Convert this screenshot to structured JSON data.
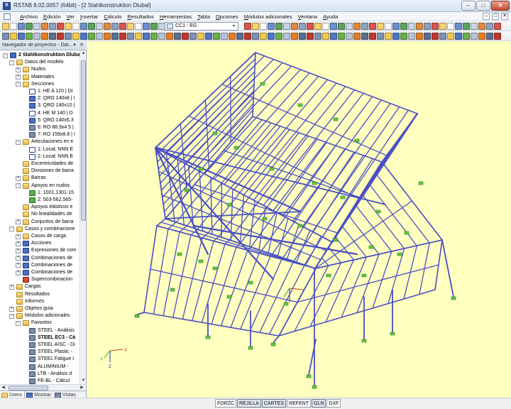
{
  "window": {
    "title": "RSTAB 8.02.0057 (64bit) - [2 Stahlkonstruktion Dlubal]",
    "minimize": "–",
    "maximize": "□",
    "close": "✕"
  },
  "menubar": {
    "items": [
      "Archivo",
      "Edición",
      "Ver",
      "Insertar",
      "Cálculo",
      "Resultados",
      "Herramientas",
      "Tabla",
      "Opciones",
      "Módulos adicionales",
      "Ventana",
      "Ayuda"
    ],
    "mdi": [
      "–",
      "□",
      "✕"
    ]
  },
  "toolbar": {
    "loadcase_combo": "CC1 - EG",
    "combo_arrow": "▾"
  },
  "navigator": {
    "title": "Navegador de proyectos - Dat...",
    "pin": "▾",
    "close": "✕",
    "rows": [
      {
        "label": "2 Stahlkonstruktion Dlubal",
        "level": 0,
        "icon": "model",
        "exp": "-",
        "bold": true
      },
      {
        "label": "Datos del modelo",
        "level": 1,
        "icon": "folder",
        "exp": "-"
      },
      {
        "label": "Nudos",
        "level": 2,
        "icon": "folder",
        "exp": "+"
      },
      {
        "label": "Materiales",
        "level": 2,
        "icon": "folder",
        "exp": "+"
      },
      {
        "label": "Secciones",
        "level": 2,
        "icon": "folder",
        "exp": "-"
      },
      {
        "label": "1: HE A 120 | DI",
        "level": 3,
        "icon": "section",
        "exp": ""
      },
      {
        "label": "2: QRO 140x8 | I",
        "level": 3,
        "icon": "blue",
        "exp": ""
      },
      {
        "label": "3: QRO 140x10 |",
        "level": 3,
        "icon": "blue",
        "exp": ""
      },
      {
        "label": "4: HE M 140 | D",
        "level": 3,
        "icon": "section",
        "exp": ""
      },
      {
        "label": "5: QRO 140x6.3",
        "level": 3,
        "icon": "blue",
        "exp": ""
      },
      {
        "label": "6: RO 88.9x4.5 |",
        "level": 3,
        "icon": "module",
        "exp": ""
      },
      {
        "label": "7: RO 159x8.8 | I",
        "level": 3,
        "icon": "module",
        "exp": ""
      },
      {
        "label": "Articulaciones en e",
        "level": 2,
        "icon": "folder",
        "exp": "-"
      },
      {
        "label": "1: Local; NNN E",
        "level": 3,
        "icon": "section",
        "exp": ""
      },
      {
        "label": "2: Local; NNN E",
        "level": 3,
        "icon": "section",
        "exp": ""
      },
      {
        "label": "Excentricidades de",
        "level": 2,
        "icon": "folder",
        "exp": ""
      },
      {
        "label": "Divisiones de barra",
        "level": 2,
        "icon": "folder",
        "exp": ""
      },
      {
        "label": "Barras",
        "level": 2,
        "icon": "folder",
        "exp": "+"
      },
      {
        "label": "Apoyos en nudos",
        "level": 2,
        "icon": "folder",
        "exp": "-"
      },
      {
        "label": "1: 1001,1301-15",
        "level": 3,
        "icon": "green",
        "exp": ""
      },
      {
        "label": "2: 503-562,565-",
        "level": 3,
        "icon": "green",
        "exp": ""
      },
      {
        "label": "Apoyos elásticos e",
        "level": 2,
        "icon": "folder",
        "exp": ""
      },
      {
        "label": "No linealidades de",
        "level": 2,
        "icon": "folder",
        "exp": ""
      },
      {
        "label": "Conjuntos de barra",
        "level": 2,
        "icon": "folder",
        "exp": "+"
      },
      {
        "label": "Casos y combinacione",
        "level": 1,
        "icon": "folder",
        "exp": "-"
      },
      {
        "label": "Casos de carga",
        "level": 2,
        "icon": "folder",
        "exp": "+"
      },
      {
        "label": "Acciones",
        "level": 2,
        "icon": "blue",
        "exp": "+"
      },
      {
        "label": "Expresiones de com",
        "level": 2,
        "icon": "blue",
        "exp": "+"
      },
      {
        "label": "Combinaciones de",
        "level": 2,
        "icon": "blue",
        "exp": "+"
      },
      {
        "label": "Combinaciones de",
        "level": 2,
        "icon": "blue",
        "exp": "+"
      },
      {
        "label": "Combinaciones de",
        "level": 2,
        "icon": "blue",
        "exp": "+"
      },
      {
        "label": "Supercombinacion",
        "level": 2,
        "icon": "red",
        "exp": ""
      },
      {
        "label": "Cargas",
        "level": 1,
        "icon": "folder",
        "exp": "+"
      },
      {
        "label": "Resultados",
        "level": 1,
        "icon": "folder",
        "exp": ""
      },
      {
        "label": "Informes",
        "level": 1,
        "icon": "folder",
        "exp": ""
      },
      {
        "label": "Objetos guía",
        "level": 1,
        "icon": "folder",
        "exp": "+"
      },
      {
        "label": "Módulos adicionales",
        "level": 1,
        "icon": "folder",
        "exp": "-"
      },
      {
        "label": "Favoritos",
        "level": 2,
        "icon": "folder",
        "exp": "-"
      },
      {
        "label": "STEEL - Análisis",
        "level": 3,
        "icon": "module",
        "exp": ""
      },
      {
        "label": "STEEL EC3 - Cá",
        "level": 3,
        "icon": "module",
        "exp": "",
        "bold": true
      },
      {
        "label": "STEEL AISC - Di",
        "level": 3,
        "icon": "module",
        "exp": ""
      },
      {
        "label": "STEEL Plastic -",
        "level": 3,
        "icon": "module",
        "exp": ""
      },
      {
        "label": "STEEL Fatigue I",
        "level": 3,
        "icon": "module",
        "exp": ""
      },
      {
        "label": "ALUMINIUM -",
        "level": 3,
        "icon": "module",
        "exp": ""
      },
      {
        "label": "LTB - Análisis d",
        "level": 3,
        "icon": "module",
        "exp": ""
      },
      {
        "label": "FE-BL - Cálcul",
        "level": 3,
        "icon": "module",
        "exp": ""
      }
    ],
    "tabs": [
      "Datos",
      "Mostrar",
      "Vistas"
    ]
  },
  "viewport": {
    "axes": {
      "x": "X",
      "y": "Y",
      "z": "Z"
    }
  },
  "statusbar": {
    "buttons": [
      "FORZC",
      "REJILLA",
      "CARTES",
      "REFENT",
      "GLN",
      "DXF"
    ],
    "active": [
      "REJILLA",
      "CARTES",
      "GLN"
    ]
  },
  "colors": {
    "members": "#4a4fc4",
    "supports": "#62cc3c",
    "background": "#ffffbf"
  }
}
